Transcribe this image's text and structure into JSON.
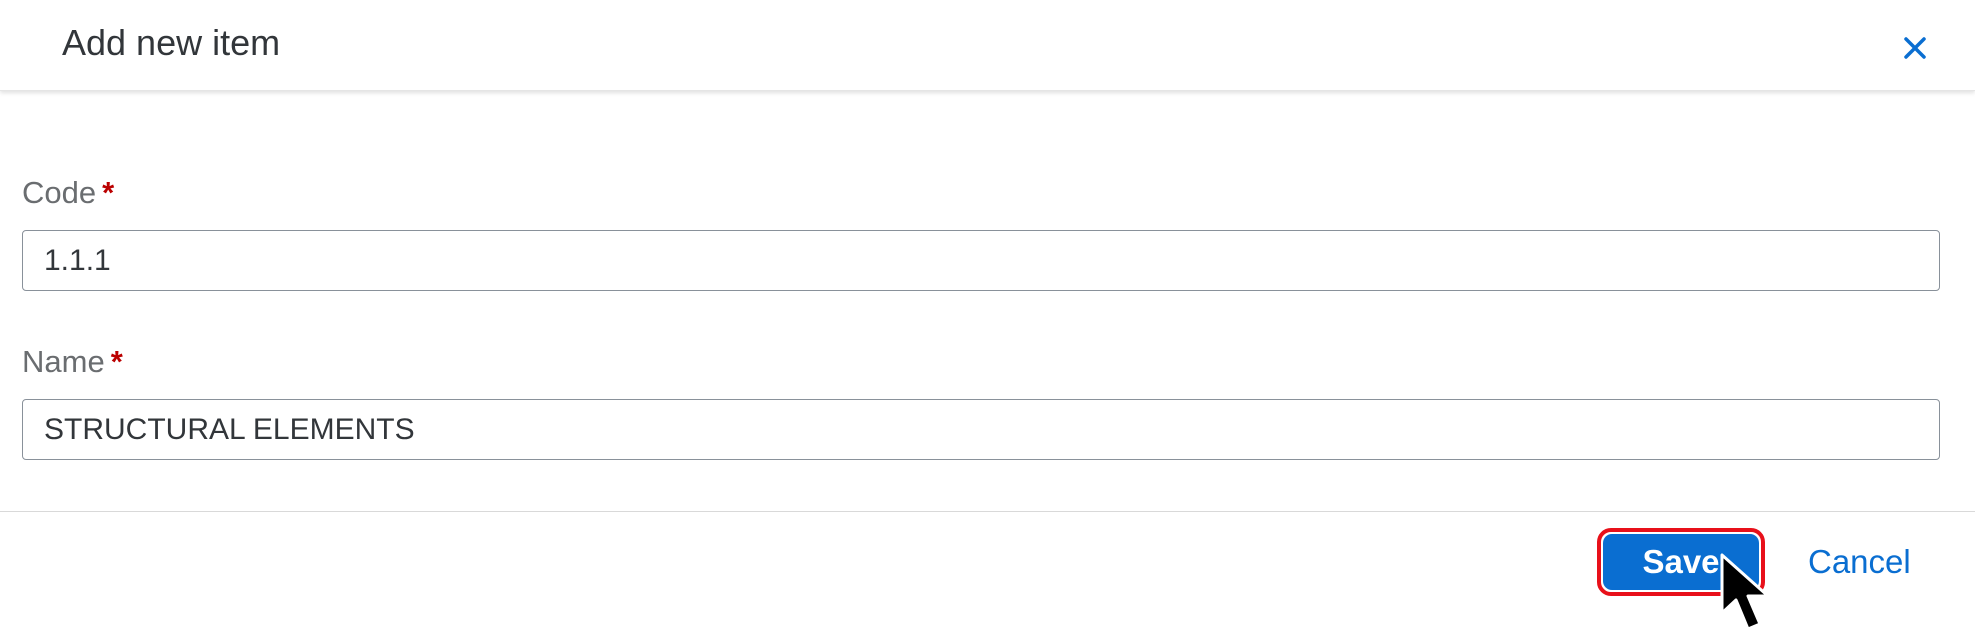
{
  "dialog": {
    "title": "Add new item",
    "close_icon": "close-icon"
  },
  "form": {
    "code": {
      "label": "Code",
      "required_mark": "*",
      "value": "1.1.1"
    },
    "name": {
      "label": "Name",
      "required_mark": "*",
      "value": "STRUCTURAL ELEMENTS"
    }
  },
  "footer": {
    "save_label": "Save",
    "cancel_label": "Cancel"
  },
  "colors": {
    "accent": "#0a6ed1",
    "required": "#bb0000",
    "highlight_border": "#e8101a"
  }
}
